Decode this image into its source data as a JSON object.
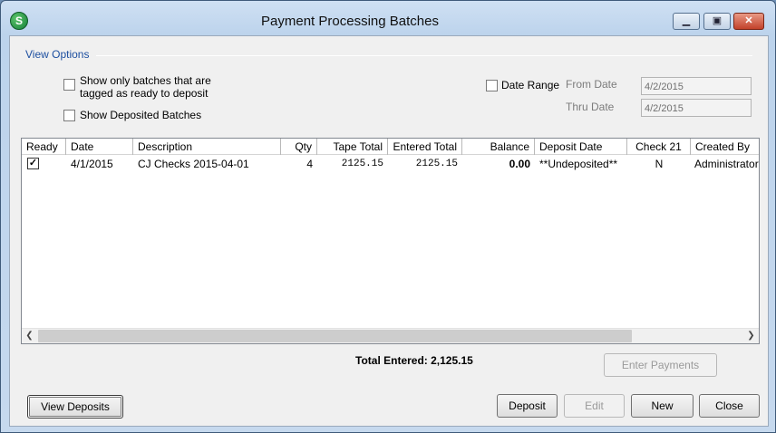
{
  "window": {
    "title": "Payment Processing Batches",
    "app_icon": "S"
  },
  "view_options": {
    "group_label": "View Options",
    "ready_only_label_line1": "Show only batches that are",
    "ready_only_label_line2": "tagged as ready to deposit",
    "show_deposited_label": "Show Deposited Batches",
    "date_range_label": "Date Range",
    "from_label": "From Date",
    "from_value": "4/2/2015",
    "thru_label": "Thru Date",
    "thru_value": "4/2/2015"
  },
  "grid": {
    "headers": [
      "Ready",
      "Date",
      "Description",
      "Qty",
      "Tape Total",
      "Entered Total",
      "Balance",
      "Deposit Date",
      "Check 21",
      "Created By"
    ],
    "rows": [
      {
        "ready": true,
        "date": "4/1/2015",
        "description": "CJ Checks 2015-04-01",
        "qty": "4",
        "tape_total": "2125.15",
        "entered_total": "2125.15",
        "balance": "0.00",
        "deposit_date": "**Undeposited**",
        "check21": "N",
        "created_by": "Administrator"
      }
    ]
  },
  "summary": {
    "total_entered": "Total Entered: 2,125.15"
  },
  "buttons": {
    "enter_payments": "Enter Payments",
    "view_deposits": "View Deposits",
    "deposit": "Deposit",
    "edit": "Edit",
    "new": "New",
    "close": "Close"
  },
  "icons": {
    "minimize": "minimize-icon",
    "maximize": "maximize-icon",
    "close": "close-icon",
    "check": "checkmark-icon",
    "scroll_left": "chevron-left-icon",
    "scroll_right": "chevron-right-icon"
  },
  "colors": {
    "accent_label": "#1d4fa0",
    "close_button": "#c2412a",
    "app_icon": "#16803a"
  }
}
